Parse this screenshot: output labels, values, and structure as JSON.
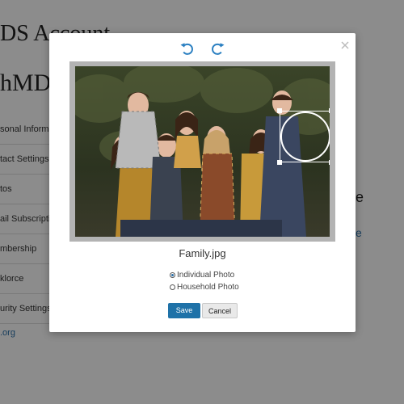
{
  "background": {
    "title": "DS Account",
    "name": "hMDi",
    "nav_items": [
      "sonal Informati",
      "tact Settings",
      "tos",
      "ail Subscriptio",
      "mbership",
      "klorce",
      "urity Settings"
    ],
    "footer_link": ".org",
    "right_heading": "e",
    "right_link": "e"
  },
  "modal": {
    "filename": "Family.jpg",
    "options": [
      {
        "label": "Individual Photo",
        "selected": true
      },
      {
        "label": "Household Photo",
        "selected": false
      }
    ],
    "save_label": "Save",
    "cancel_label": "Cancel",
    "icons": {
      "rotate_left": "rotate-left-icon",
      "rotate_right": "rotate-right-icon",
      "close": "close-icon"
    },
    "accent_color": "#1f72a8"
  }
}
